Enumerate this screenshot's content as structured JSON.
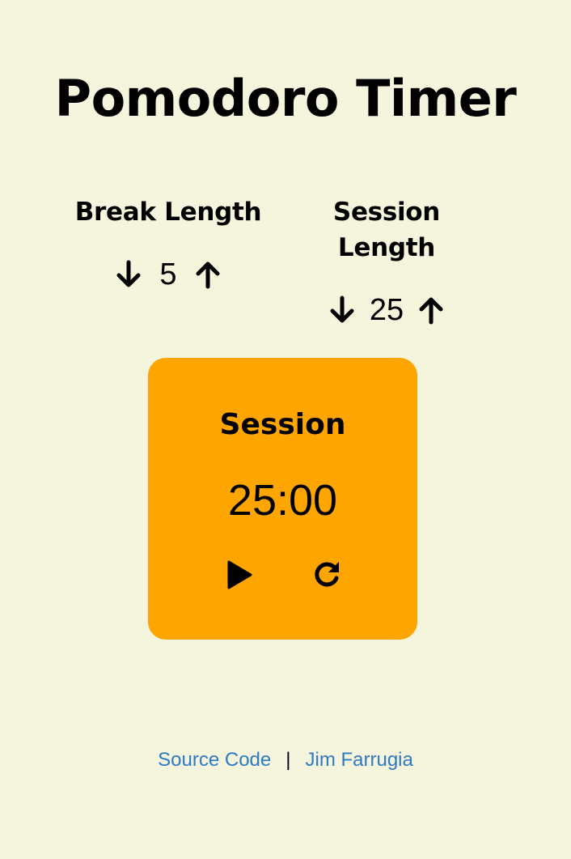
{
  "header": {
    "title": "Pomodoro Timer"
  },
  "break_control": {
    "label": "Break Length",
    "value": "5",
    "decrement_icon": "arrow-down-icon",
    "increment_icon": "arrow-up-icon"
  },
  "session_control": {
    "label": "Session Length",
    "value": "25",
    "decrement_icon": "arrow-down-icon",
    "increment_icon": "arrow-up-icon"
  },
  "timer": {
    "label": "Session",
    "time": "25:00",
    "play_icon": "play-icon",
    "reset_icon": "refresh-icon",
    "background_color": "#ffa500"
  },
  "footer": {
    "source_link": "Source Code",
    "separator": "|",
    "author_link": "Jim Farrugia",
    "link_color": "#2f7ac4"
  },
  "page": {
    "background_color": "#f5f4dc"
  }
}
